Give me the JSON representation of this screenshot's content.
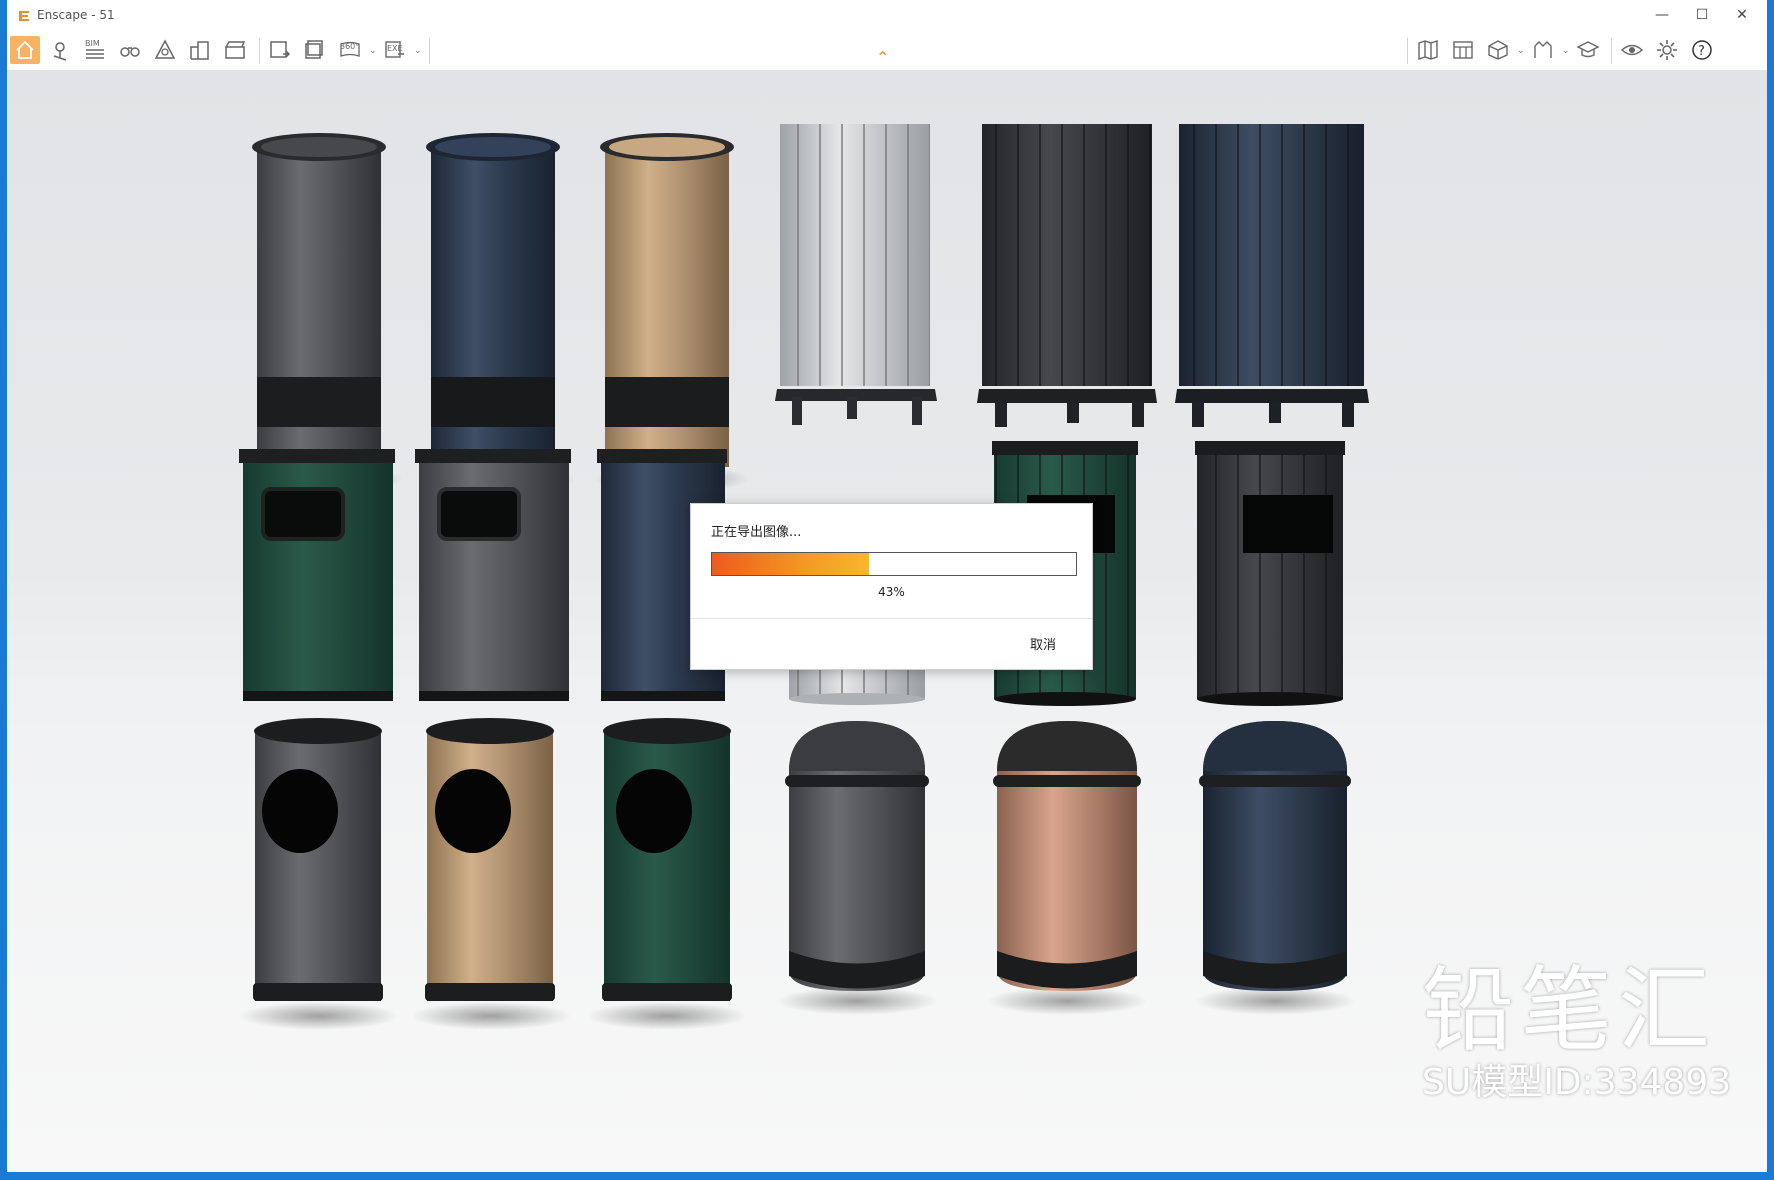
{
  "window": {
    "title": "Enscape - 51",
    "controls": {
      "minimize": "—",
      "maximize": "☐",
      "close": "✕"
    }
  },
  "toolbar": {
    "bim_label": "BIM",
    "pano_label": "360°",
    "exe_label": "EXE"
  },
  "colors": {
    "accent": "#f39a24",
    "progress_start": "#ef5a1e",
    "titlebar": "#ffffff",
    "taskbar_edge": "#1a7ad4"
  },
  "dialog": {
    "title": "正在导出图像...",
    "progress": 0.43,
    "progress_label": "43%",
    "cancel": "取消"
  },
  "watermark": {
    "brand": "铅笔汇",
    "model_id": "SU模型ID:334893"
  }
}
